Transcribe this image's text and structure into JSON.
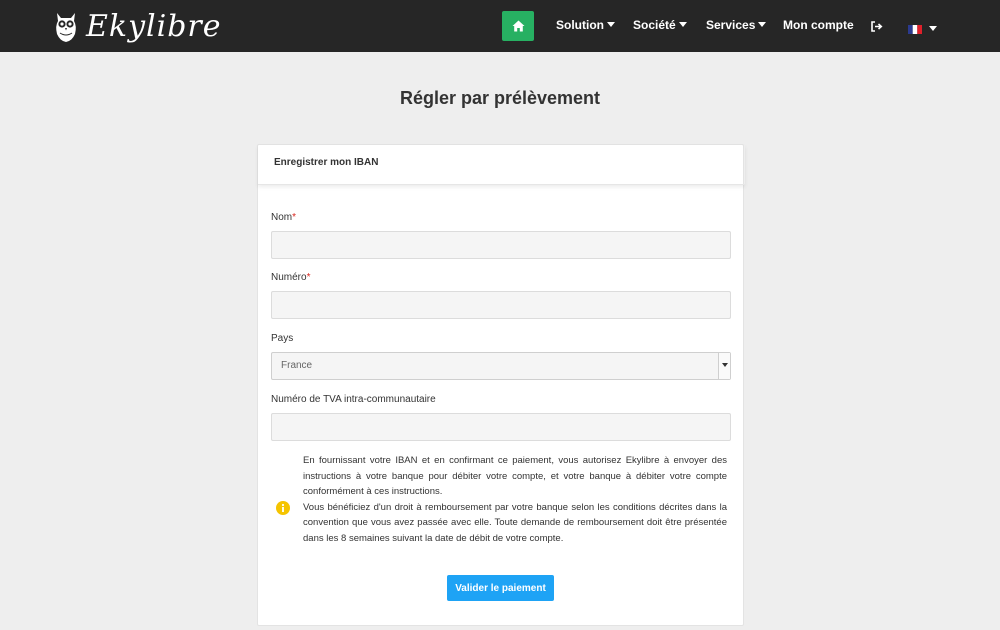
{
  "nav": {
    "brand": "Ekylibre",
    "home_icon": "home-icon",
    "items": [
      {
        "label": "Solution",
        "dropdown": true
      },
      {
        "label": "Société",
        "dropdown": true
      },
      {
        "label": "Services",
        "dropdown": true
      },
      {
        "label": "Mon compte",
        "dropdown": false
      }
    ],
    "logout_icon": "sign-out-icon",
    "language_icon": "french-flag-icon"
  },
  "page": {
    "title": "Régler par prélèvement"
  },
  "form": {
    "header": "Enregistrer mon IBAN",
    "fields": {
      "nom": {
        "label": "Nom",
        "required_mark": "*",
        "value": ""
      },
      "numero": {
        "label": "Numéro",
        "required_mark": "*",
        "value": ""
      },
      "pays": {
        "label": "Pays",
        "value": "France"
      },
      "tva": {
        "label": "Numéro de TVA intra-communautaire",
        "value": ""
      }
    },
    "consent": {
      "icon": "info-icon",
      "paragraph1": "En fournissant votre IBAN et en confirmant ce paiement, vous autorisez Ekylibre à envoyer des instructions à votre banque pour débiter votre compte, et votre banque à débiter votre compte conformément à ces instructions.",
      "paragraph2": "Vous bénéficiez d'un droit à remboursement par votre banque selon les conditions décrites dans la convention que vous avez passée avec elle. Toute demande de remboursement doit être présentée dans les 8 semaines suivant la date de débit de votre compte."
    },
    "submit_label": "Valider le paiement"
  },
  "colors": {
    "navbar": "#262626",
    "home_button": "#27b062",
    "submit_button": "#1ea3f5",
    "required": "#d9251d",
    "info_icon": "#f5c400"
  }
}
